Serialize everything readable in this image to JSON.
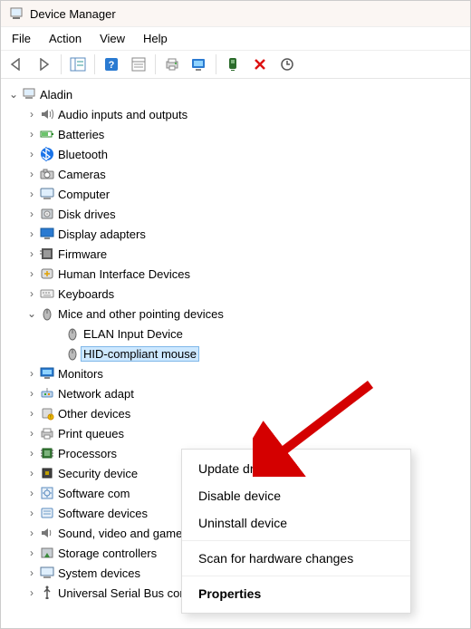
{
  "window_title": "Device Manager",
  "menubar": [
    "File",
    "Action",
    "View",
    "Help"
  ],
  "toolbar": [
    "back",
    "forward",
    "sep",
    "properties-frame",
    "sep",
    "help",
    "refresh",
    "sep",
    "print",
    "monitor",
    "sep",
    "plug",
    "delete",
    "scan"
  ],
  "root_name": "Aladin",
  "categories": [
    {
      "label": "Audio inputs and outputs",
      "icon": "speaker",
      "chev": ">"
    },
    {
      "label": "Batteries",
      "icon": "battery",
      "chev": ">"
    },
    {
      "label": "Bluetooth",
      "icon": "bluetooth",
      "chev": ">"
    },
    {
      "label": "Cameras",
      "icon": "camera",
      "chev": ">"
    },
    {
      "label": "Computer",
      "icon": "computer",
      "chev": ">"
    },
    {
      "label": "Disk drives",
      "icon": "disk",
      "chev": ">"
    },
    {
      "label": "Display adapters",
      "icon": "display",
      "chev": ">"
    },
    {
      "label": "Firmware",
      "icon": "firmware",
      "chev": ">"
    },
    {
      "label": "Human Interface Devices",
      "icon": "hid",
      "chev": ">"
    },
    {
      "label": "Keyboards",
      "icon": "keyboard",
      "chev": ">"
    },
    {
      "label": "Mice and other pointing devices",
      "icon": "mouse",
      "chev": "v",
      "children": [
        {
          "label": "ELAN Input Device",
          "icon": "mouse"
        },
        {
          "label": "HID-compliant mouse",
          "icon": "mouse",
          "selected": true
        }
      ]
    },
    {
      "label": "Monitors",
      "icon": "monitor",
      "chev": ">"
    },
    {
      "label": "Network adapters",
      "icon": "network",
      "chev": ">",
      "truncated": "Network adapt"
    },
    {
      "label": "Other devices",
      "icon": "other",
      "chev": ">",
      "truncated": "Other devices"
    },
    {
      "label": "Print queues",
      "icon": "printer",
      "chev": ">"
    },
    {
      "label": "Processors",
      "icon": "cpu",
      "chev": ">"
    },
    {
      "label": "Security devices",
      "icon": "security",
      "chev": ">",
      "truncated": "Security device"
    },
    {
      "label": "Software components",
      "icon": "swcomp",
      "chev": ">",
      "truncated": "Software com"
    },
    {
      "label": "Software devices",
      "icon": "swdev",
      "chev": ">"
    },
    {
      "label": "Sound, video and game controllers",
      "icon": "sound",
      "chev": ">"
    },
    {
      "label": "Storage controllers",
      "icon": "storage",
      "chev": ">"
    },
    {
      "label": "System devices",
      "icon": "system",
      "chev": ">"
    },
    {
      "label": "Universal Serial Bus controllers",
      "icon": "usb",
      "chev": ">",
      "truncated": "Universal Serial Bus controllers"
    }
  ],
  "context_menu": [
    {
      "label": "Update driver",
      "kind": "item"
    },
    {
      "label": "Disable device",
      "kind": "item"
    },
    {
      "label": "Uninstall device",
      "kind": "item"
    },
    {
      "kind": "sep"
    },
    {
      "label": "Scan for hardware changes",
      "kind": "item"
    },
    {
      "kind": "sep"
    },
    {
      "label": "Properties",
      "kind": "bold"
    }
  ]
}
